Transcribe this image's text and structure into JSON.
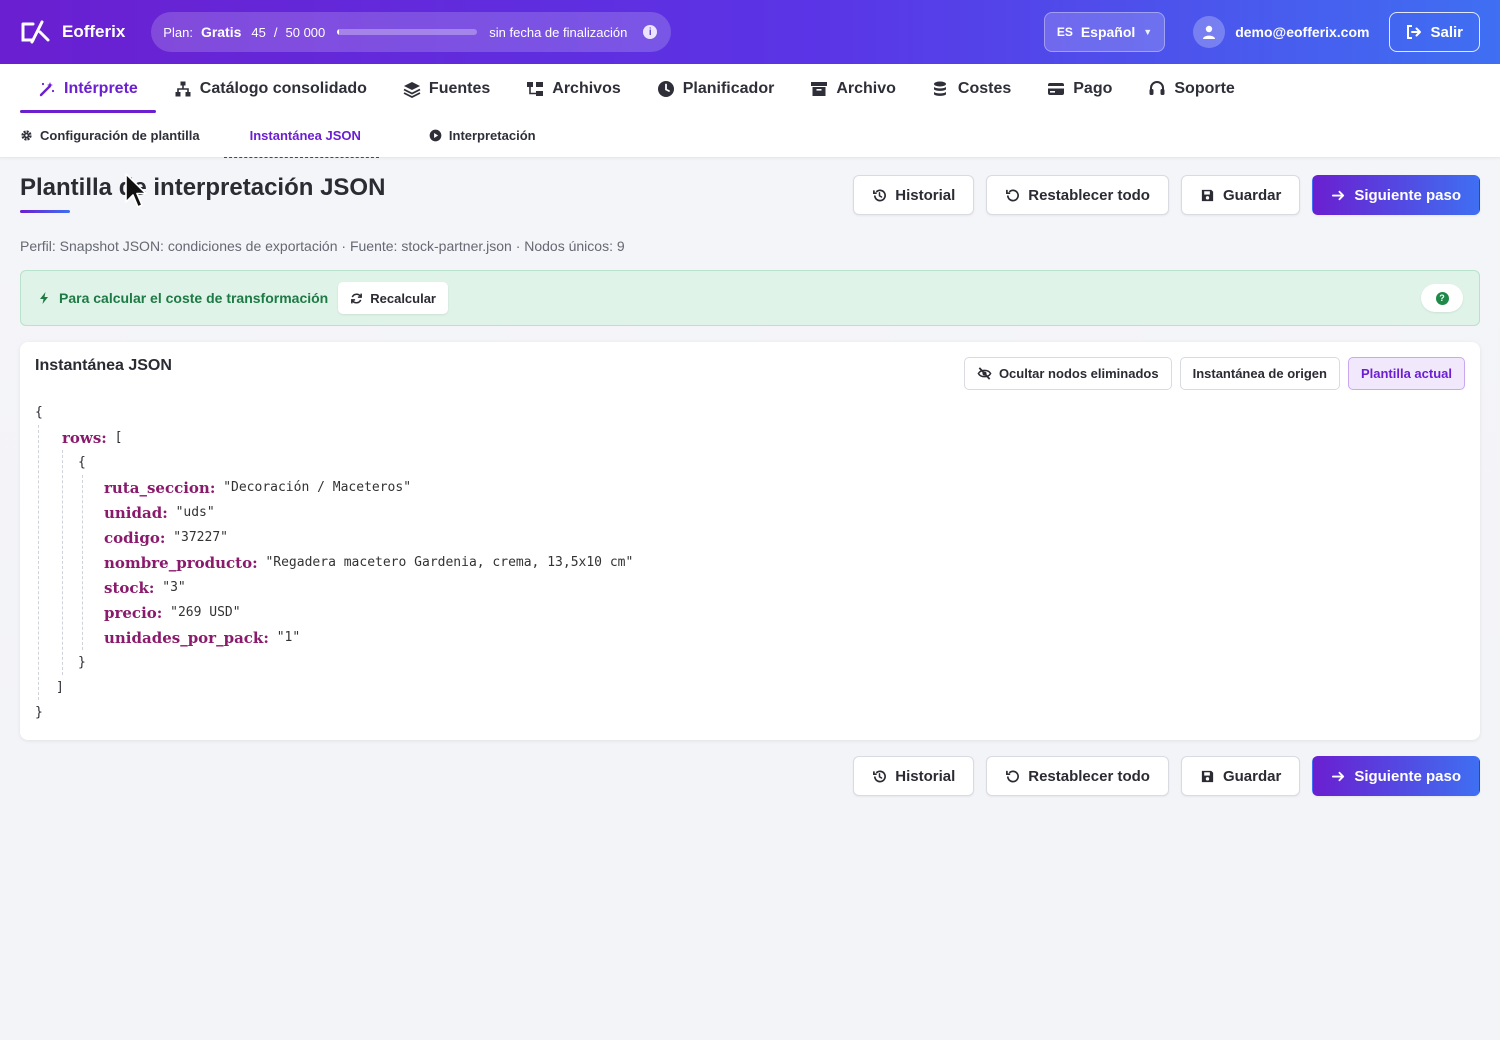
{
  "app": {
    "name": "Eofferix",
    "plan_label": "Plan:",
    "plan_name": "Gratis",
    "usage_used": "45",
    "usage_sep": "/",
    "usage_total": "50 000",
    "usage_fraction": 0.0009,
    "plan_expiry": "sin fecha de finalización",
    "lang_code": "ES",
    "lang_name": "Español",
    "user_email": "demo@eofferix.com",
    "logout_label": "Salir"
  },
  "nav": {
    "items": [
      {
        "label": "Intérprete",
        "icon": "magic-wand-icon",
        "active": true
      },
      {
        "label": "Catálogo consolidado",
        "icon": "sitemap-icon"
      },
      {
        "label": "Fuentes",
        "icon": "layers-icon"
      },
      {
        "label": "Archivos",
        "icon": "folder-tree-icon"
      },
      {
        "label": "Planificador",
        "icon": "clock-icon"
      },
      {
        "label": "Archivo",
        "icon": "archive-icon"
      },
      {
        "label": "Costes",
        "icon": "coins-icon"
      },
      {
        "label": "Pago",
        "icon": "credit-card-icon"
      },
      {
        "label": "Soporte",
        "icon": "headset-icon"
      }
    ]
  },
  "subnav": {
    "items": [
      {
        "label": "Configuración de plantilla",
        "icon": "gear-icon"
      },
      {
        "label": "Instantánea JSON",
        "active": true
      },
      {
        "label": "Interpretación",
        "icon": "play-circle-icon"
      }
    ]
  },
  "page": {
    "title": "Plantilla de interpretación JSON",
    "meta": "Perfil: Snapshot JSON: condiciones de exportación · Fuente: stock-partner.json · Nodos únicos: 9"
  },
  "actions": {
    "history": "Historial",
    "reset": "Restablecer todo",
    "save": "Guardar",
    "next": "Siguiente paso"
  },
  "banner": {
    "text": "Para calcular el coste de transformación",
    "recalc": "Recalcular",
    "accent": "#1e7a45"
  },
  "card": {
    "title": "Instantánea JSON",
    "tools": {
      "hide_deleted": "Ocultar nodos eliminados",
      "source_snapshot": "Instantánea de origen",
      "current_template": "Plantilla actual"
    }
  },
  "json": {
    "open_brace": "{",
    "rows_key": "rows:",
    "open_bracket": "[",
    "item_open": "{",
    "fields": [
      {
        "key": "ruta_seccion:",
        "value": "\"Decoración / Maceteros\""
      },
      {
        "key": "unidad:",
        "value": "\"uds\""
      },
      {
        "key": "codigo:",
        "value": "\"37227\""
      },
      {
        "key": "nombre_producto:",
        "value": "\"Regadera macetero Gardenia, crema, 13,5x10 cm\""
      },
      {
        "key": "stock:",
        "value": "\"3\""
      },
      {
        "key": "precio:",
        "value": "\"269 USD\""
      },
      {
        "key": "unidades_por_pack:",
        "value": "\"1\""
      }
    ],
    "item_close": "}",
    "close_bracket": "]",
    "close_brace": "}"
  },
  "colors": {
    "brand_start": "#6a1fd0",
    "brand_end": "#3f6ff2",
    "json_key": "#8a1a6c"
  }
}
